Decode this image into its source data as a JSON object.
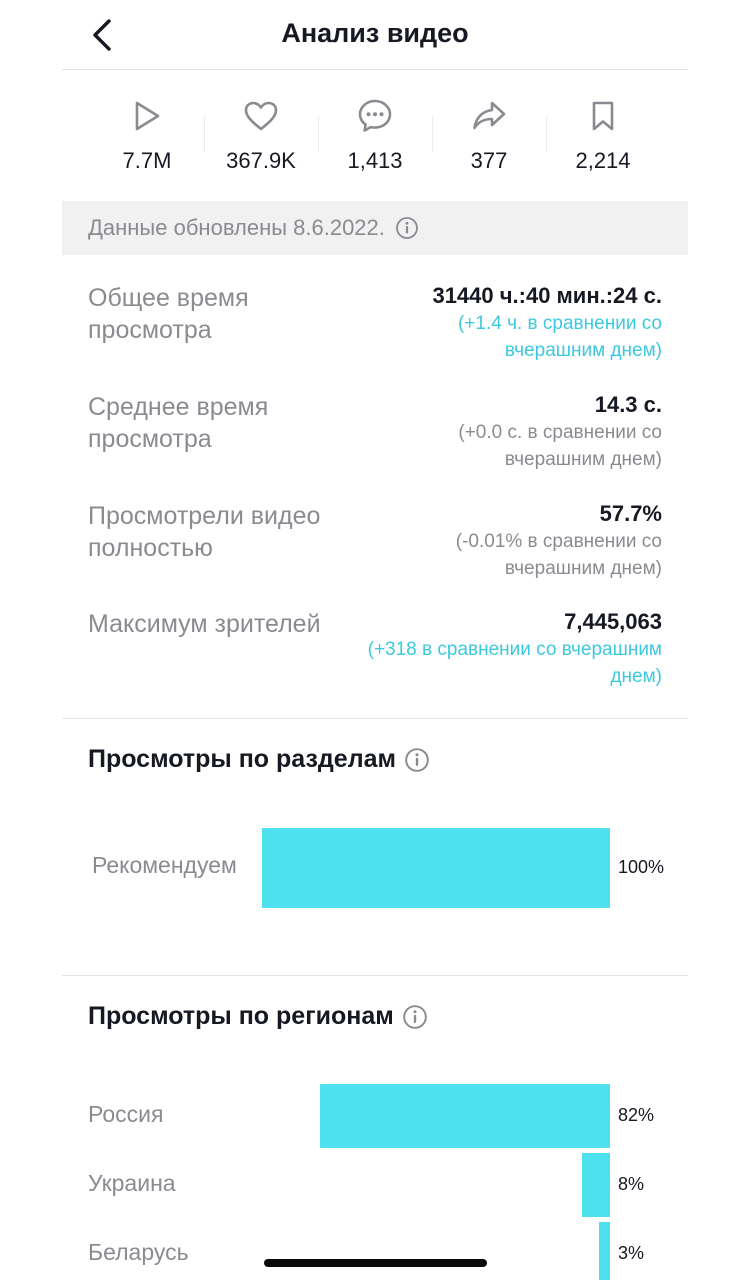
{
  "header": {
    "title": "Анализ видео"
  },
  "stats": [
    {
      "icon": "play-icon",
      "value": "7.7M"
    },
    {
      "icon": "heart-icon",
      "value": "367.9K"
    },
    {
      "icon": "comment-icon",
      "value": "1,413"
    },
    {
      "icon": "share-icon",
      "value": "377"
    },
    {
      "icon": "bookmark-icon",
      "value": "2,214"
    }
  ],
  "updated": {
    "text": "Данные обновлены 8.6.2022."
  },
  "metrics": [
    {
      "label": "Общее время просмотра",
      "value": "31440 ч.:40 мин.:24 с.",
      "comparison": "(+1.4 ч. в сравнении со вчерашним днем)"
    },
    {
      "label": "Среднее время просмотра",
      "value": "14.3 с.",
      "comparison": "(+0.0 с. в сравнении со вчерашним днем)"
    },
    {
      "label": "Просмотрели видео полностью",
      "value": "57.7%",
      "comparison": "(-0.01% в сравнении со вчерашним днем)"
    },
    {
      "label": "Максимум зрителей",
      "value": "7,445,063",
      "comparison": "(+318 в сравнении со вчерашним днем)"
    }
  ],
  "sections": {
    "views_by_section": {
      "title": "Просмотры по разделам",
      "rows": [
        {
          "label": "Рекомендуем",
          "percent": "100%",
          "value": 100
        }
      ]
    },
    "views_by_region": {
      "title": "Просмотры по регионам",
      "rows": [
        {
          "label": "Россия",
          "percent": "82%",
          "value": 82
        },
        {
          "label": "Украина",
          "percent": "8%",
          "value": 8
        },
        {
          "label": "Беларусь",
          "percent": "3%",
          "value": 3
        }
      ]
    }
  },
  "colors": {
    "accent": "#4de0ee",
    "positive_text": "#3cc9de",
    "muted_text": "#8a8b91",
    "text": "#161823"
  }
}
